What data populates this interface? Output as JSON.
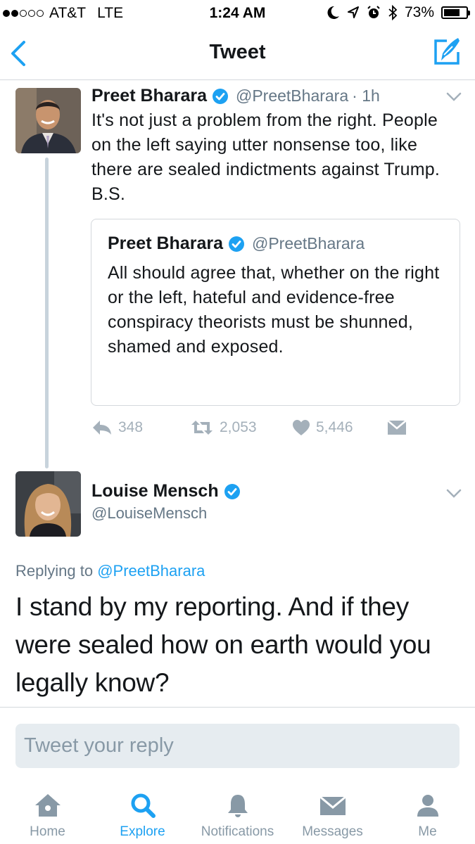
{
  "status_bar": {
    "carrier": "AT&T",
    "network": "LTE",
    "time": "1:24 AM",
    "battery": "73%",
    "battery_level": 0.73,
    "signal_bars": 2,
    "signal_total": 5
  },
  "nav": {
    "title": "Tweet",
    "back_icon": "chevron-left-icon",
    "compose_icon": "compose-tweet-icon"
  },
  "colors": {
    "accent": "#1da1f2",
    "text": "#14171a",
    "secondary": "#657786",
    "action": "#a4b0ba",
    "border": "#d4d8dc",
    "input_bg": "#e6ecf0"
  },
  "tweet": {
    "author": "Preet Bharara",
    "handle": "@PreetBharara",
    "time": "· 1h",
    "text": "It's not just a problem from the right. People on the left saying utter nonsense too, like there are sealed indictments against Trump. B.S.",
    "quoted": {
      "author": "Preet Bharara",
      "handle": "@PreetBharara",
      "text": "All should agree that, whether on the right or the left, hateful and evidence-free conspiracy theorists must be shunned, shamed and exposed."
    },
    "replies": "348",
    "retweets": "2,053",
    "likes": "5,446"
  },
  "reply": {
    "author": "Louise Mensch",
    "handle": "@LouiseMensch",
    "replying_prefix": "Replying to",
    "replying_to": "@PreetBharara",
    "text": "I stand by my reporting. And if they were sealed how on earth would you legally know?"
  },
  "composer": {
    "placeholder": "Tweet your reply"
  },
  "tabs": [
    {
      "label": "Home",
      "icon": "home-icon",
      "active": false
    },
    {
      "label": "Explore",
      "icon": "search-icon",
      "active": true
    },
    {
      "label": "Notifications",
      "icon": "bell-icon",
      "active": false
    },
    {
      "label": "Messages",
      "icon": "envelope-icon",
      "active": false
    },
    {
      "label": "Me",
      "icon": "person-icon",
      "active": false
    }
  ]
}
